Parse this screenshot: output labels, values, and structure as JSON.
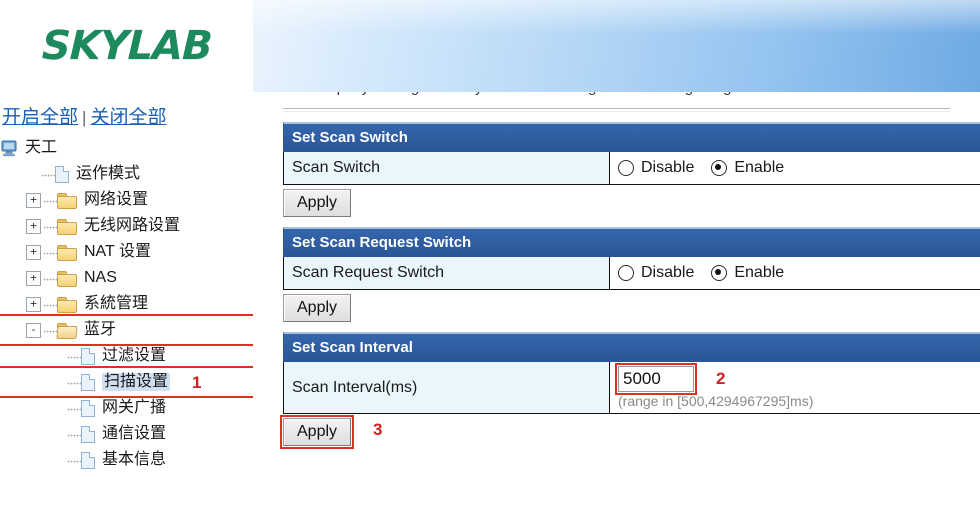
{
  "brand": {
    "logo_text": "SKYLAB"
  },
  "sidebar": {
    "expand_all": "开启全部",
    "separator": "|",
    "collapse_all": "关闭全部",
    "tree": [
      {
        "label": "天工",
        "icon": "computer-icon",
        "toggle": "",
        "level": 0
      },
      {
        "label": "运作模式",
        "icon": "page-icon",
        "toggle": "",
        "level": 1
      },
      {
        "label": "网络设置",
        "icon": "folder-icon",
        "toggle": "+",
        "level": 1
      },
      {
        "label": "无线网路设置",
        "icon": "folder-icon",
        "toggle": "+",
        "level": 1
      },
      {
        "label": "NAT 设置",
        "icon": "folder-icon",
        "toggle": "+",
        "level": 1
      },
      {
        "label": "NAS",
        "icon": "folder-icon",
        "toggle": "+",
        "level": 1
      },
      {
        "label": "系統管理",
        "icon": "folder-icon",
        "toggle": "+",
        "level": 1
      },
      {
        "label": "蓝牙",
        "icon": "folder-open-icon",
        "toggle": "-",
        "level": 1
      },
      {
        "label": "过滤设置",
        "icon": "page-icon",
        "toggle": "",
        "level": 2
      },
      {
        "label": "扫描设置",
        "icon": "page-icon",
        "toggle": "",
        "level": 2
      },
      {
        "label": "网关广播",
        "icon": "page-icon",
        "toggle": "",
        "level": 2
      },
      {
        "label": "通信设置",
        "icon": "page-icon",
        "toggle": "",
        "level": 2
      },
      {
        "label": "基本信息",
        "icon": "page-icon",
        "toggle": "",
        "level": 2
      }
    ]
  },
  "annotations": {
    "one": "1",
    "two": "2",
    "three": "3"
  },
  "main": {
    "scan_switch": {
      "title": "Set Scan Switch",
      "label": "Scan Switch",
      "option_disable": "Disable",
      "option_enable": "Enable",
      "selected": "Enable",
      "apply_label": "Apply"
    },
    "scan_request_switch": {
      "title": "Set Scan Request Switch",
      "label": "Scan Request Switch",
      "option_disable": "Disable",
      "option_enable": "Enable",
      "selected": "Enable",
      "apply_label": "Apply"
    },
    "scan_interval": {
      "title": "Set Scan Interval",
      "label": "Scan Interval(ms)",
      "value": "5000",
      "hint": "(range in [500,4294967295]ms)",
      "apply_label": "Apply"
    }
  },
  "colors": {
    "panel_header": "#2a5697",
    "label_cell": "#e9f6fb",
    "logo_green": "#1d8a5e",
    "link_blue": "#1a5fb4",
    "annotation_red": "#d02020"
  }
}
